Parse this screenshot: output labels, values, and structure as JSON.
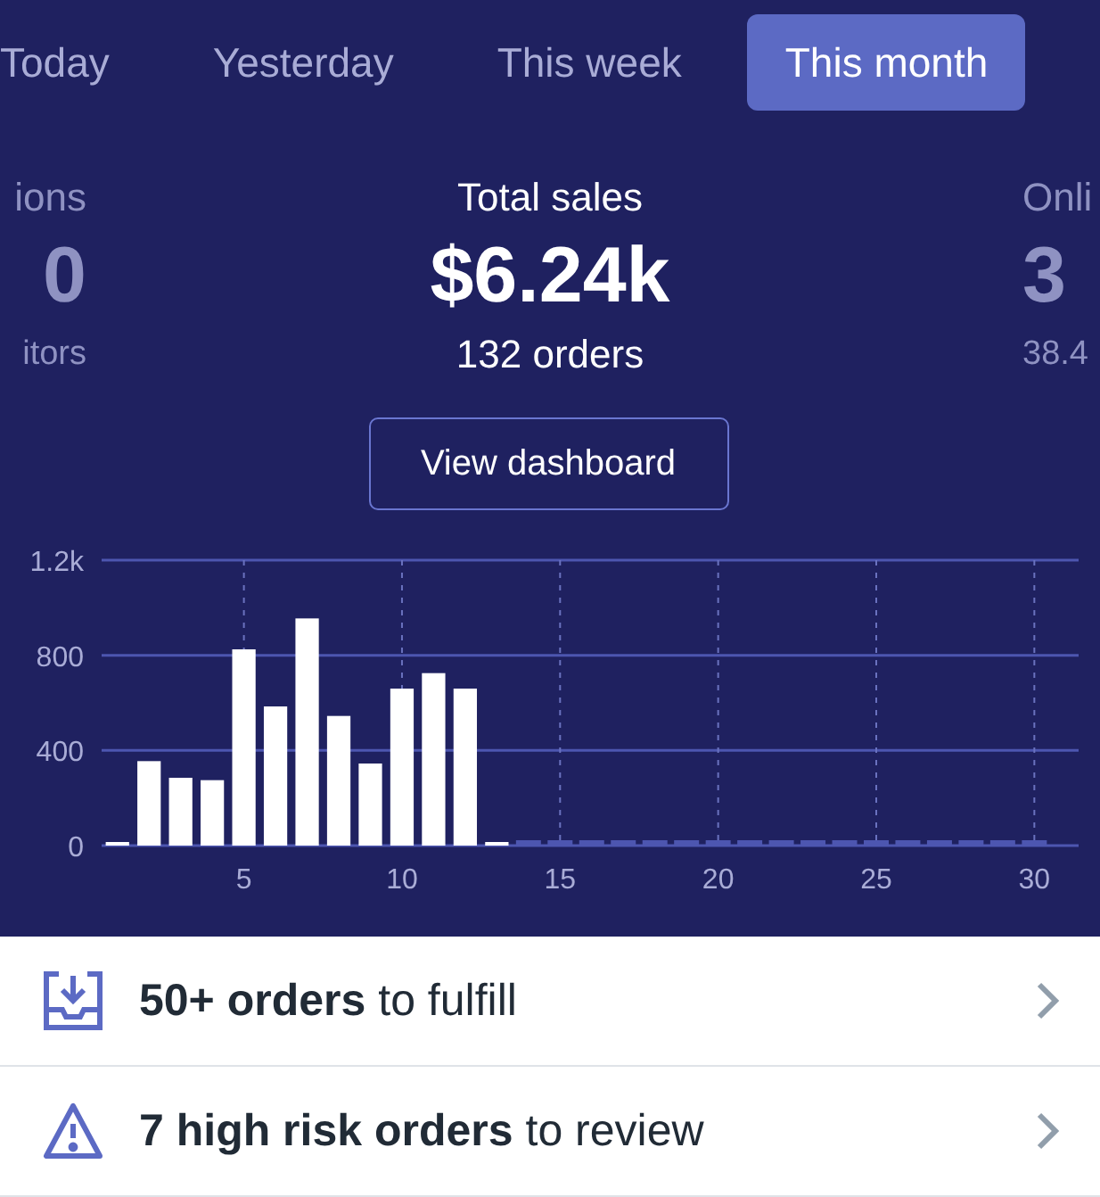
{
  "tabs": [
    {
      "label": "Today",
      "selected": false
    },
    {
      "label": "Yesterday",
      "selected": false
    },
    {
      "label": "This week",
      "selected": false
    },
    {
      "label": "This month",
      "selected": true
    }
  ],
  "stats": {
    "left": {
      "label": "ions",
      "value": "0",
      "sub": "itors"
    },
    "center": {
      "label": "Total sales",
      "value": "$6.24k",
      "sub": "132 orders"
    },
    "right": {
      "label": "Onli",
      "value": "3",
      "sub": "38.4"
    }
  },
  "dashboard_button": "View dashboard",
  "chart_data": {
    "type": "bar",
    "x": [
      1,
      2,
      3,
      4,
      5,
      6,
      7,
      8,
      9,
      10,
      11,
      12,
      13
    ],
    "values": [
      15,
      355,
      285,
      275,
      825,
      585,
      955,
      545,
      345,
      660,
      725,
      660,
      15
    ],
    "xlim": [
      0.5,
      31.4
    ],
    "ylim": [
      0,
      1200
    ],
    "grid": true,
    "yticks": [
      0,
      400,
      800,
      {
        "value": 1200,
        "label": "1.2k"
      }
    ],
    "xticks": [
      5,
      10,
      15,
      20,
      25,
      30
    ]
  },
  "tasks": [
    {
      "kind": "fulfill",
      "text": "**50+ orders** to fulfill"
    },
    {
      "kind": "risk",
      "text": "**7 high risk orders** to review"
    }
  ]
}
